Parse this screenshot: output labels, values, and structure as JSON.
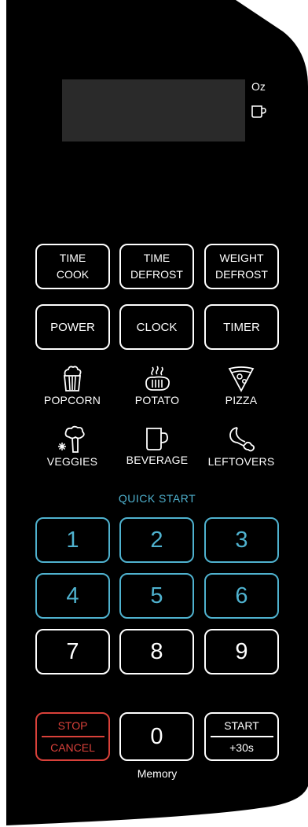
{
  "display": {
    "unit_oz": "Oz",
    "unit_cup_icon": "cup-icon"
  },
  "function_keys": {
    "time_cook": [
      "TIME",
      "COOK"
    ],
    "time_defrost": [
      "TIME",
      "DEFROST"
    ],
    "weight_defrost": [
      "WEIGHT",
      "DEFROST"
    ],
    "power": "POWER",
    "clock": "CLOCK",
    "timer": "TIMER"
  },
  "presets": [
    {
      "label": "POPCORN",
      "icon": "popcorn-icon"
    },
    {
      "label": "POTATO",
      "icon": "potato-icon"
    },
    {
      "label": "PIZZA",
      "icon": "pizza-icon"
    },
    {
      "label": "VEGGIES",
      "icon": "veggies-icon"
    },
    {
      "label": "BEVERAGE",
      "icon": "beverage-icon"
    },
    {
      "label": "LEFTOVERS",
      "icon": "leftovers-icon"
    }
  ],
  "quick_start_label": "QUICK START",
  "number_keys": [
    "1",
    "2",
    "3",
    "4",
    "5",
    "6",
    "7",
    "8",
    "9",
    "0"
  ],
  "stop_cancel": [
    "STOP",
    "CANCEL"
  ],
  "start": [
    "START",
    "+30s"
  ],
  "memory_label": "Memory",
  "colors": {
    "panel": "#000000",
    "key_border": "#ffffff",
    "quick_start": "#4fb2cf",
    "stop": "#d9413a",
    "display": "#2a2a2a"
  }
}
